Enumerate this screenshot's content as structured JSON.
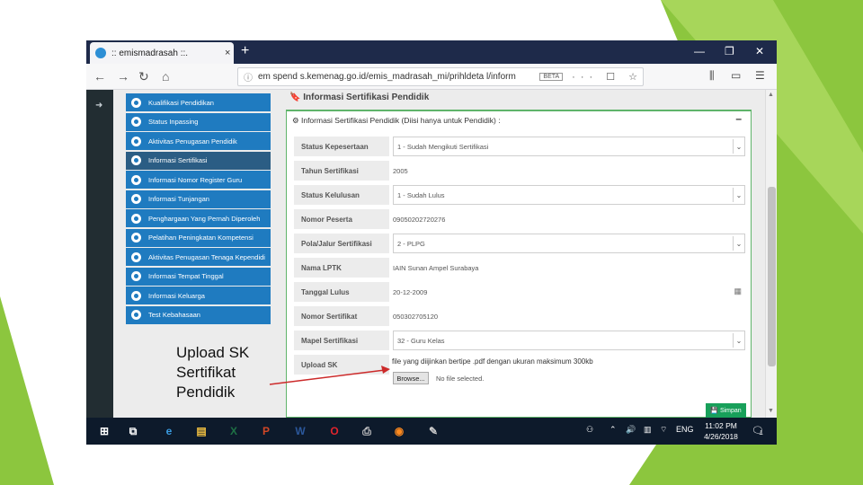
{
  "browser": {
    "tab_title": ":: emismadrasah ::.",
    "tab_close": "×",
    "new_tab": "+",
    "window_controls": [
      "—",
      "❐",
      "✕"
    ],
    "url": "em spend s.kemenag.go.id/emis_madrasah_mi/prihldeta l/inform",
    "url_badge": "BETA",
    "url_actions": "··· ☐ ☆",
    "nav": {
      "back": "←",
      "forward": "→",
      "reload": "↻",
      "home": "⌂"
    },
    "right_tools": [
      "⫼",
      "▭",
      "☰"
    ]
  },
  "sidebar": {
    "items": [
      {
        "label": "Kualifikasi Pendidikan",
        "active": false
      },
      {
        "label": "Status Inpassing",
        "active": false
      },
      {
        "label": "Aktivitas Penugasan Pendidik",
        "active": false
      },
      {
        "label": "Informasi Sertifikasi",
        "active": true
      },
      {
        "label": "Informasi Nomor Register Guru",
        "active": false
      },
      {
        "label": "Informasi Tunjangan",
        "active": false
      },
      {
        "label": "Penghargaan Yang Pernah Diperoleh",
        "active": false
      },
      {
        "label": "Pelatihan Peningkatan Kompetensi",
        "active": false
      },
      {
        "label": "Aktivitas Penugasan Tenaga Kependidi",
        "active": false
      },
      {
        "label": "Informasi Tempat Tinggal",
        "active": false
      },
      {
        "label": "Informasi Keluarga",
        "active": false
      },
      {
        "label": "Test Kebahasaan",
        "active": false
      }
    ]
  },
  "main": {
    "heading": "🔖 Informasi Sertifikasi Pendidik",
    "panel_title": "⚙ Informasi Sertifikasi Pendidik (Diisi hanya untuk Pendidik) :",
    "panel_collapse": "–",
    "fields": [
      {
        "label": "Status Kepesertaan",
        "value": "1 - Sudah Mengikuti Sertifikasi",
        "type": "select"
      },
      {
        "label": "Tahun Sertifikasi",
        "value": "2005",
        "type": "text"
      },
      {
        "label": "Status Kelulusan",
        "value": "1 - Sudah Lulus",
        "type": "select"
      },
      {
        "label": "Nomor Peserta",
        "value": "09050202720276",
        "type": "text"
      },
      {
        "label": "Pola/Jalur Sertifikasi",
        "value": "2 - PLPG",
        "type": "select"
      },
      {
        "label": "Nama LPTK",
        "value": "IAIN Sunan Ampel Surabaya",
        "type": "text"
      },
      {
        "label": "Tanggal Lulus",
        "value": "20-12-2009",
        "type": "date"
      },
      {
        "label": "Nomor Sertifikat",
        "value": "050302705120",
        "type": "text"
      },
      {
        "label": "Mapel Sertifikasi",
        "value": "32 - Guru Kelas",
        "type": "select"
      },
      {
        "label": "Upload SK",
        "value": "",
        "type": "file"
      }
    ],
    "upload_hint": "file yang diijinkan bertipe .pdf dengan ukuran maksimum 300kb",
    "browse_label": "Browse...",
    "file_name": "No file selected.",
    "save_label": "💾 Simpan"
  },
  "taskbar": {
    "apps": [
      {
        "name": "start",
        "glyph": "⊞",
        "color": "#ffffff"
      },
      {
        "name": "task-view",
        "glyph": "⧉",
        "color": "#ffffff"
      },
      {
        "name": "edge",
        "glyph": "e",
        "color": "#3a9be0"
      },
      {
        "name": "file-explorer",
        "glyph": "▤",
        "color": "#f3c241"
      },
      {
        "name": "excel",
        "glyph": "X",
        "color": "#1e7145"
      },
      {
        "name": "powerpoint",
        "glyph": "P",
        "color": "#d24726"
      },
      {
        "name": "word",
        "glyph": "W",
        "color": "#2b579a"
      },
      {
        "name": "opera",
        "glyph": "O",
        "color": "#e0242c"
      },
      {
        "name": "printer",
        "glyph": "⎙",
        "color": "#cccccc"
      },
      {
        "name": "firefox",
        "glyph": "◉",
        "color": "#ff8a1e"
      },
      {
        "name": "misc-app",
        "glyph": "✎",
        "color": "#cccccc"
      }
    ],
    "lang": "ENG",
    "time": "11:02 PM",
    "date": "4/26/2018",
    "notification_count": "1"
  },
  "caption": {
    "line1": "Upload SK",
    "line2": "Sertifikat",
    "line3": "Pendidik"
  },
  "colors": {
    "accent_green": "#8cc63e",
    "sidebar_blue": "#1f7bc0",
    "save_green": "#18a05a",
    "arrow_red": "#cc2a2a"
  }
}
